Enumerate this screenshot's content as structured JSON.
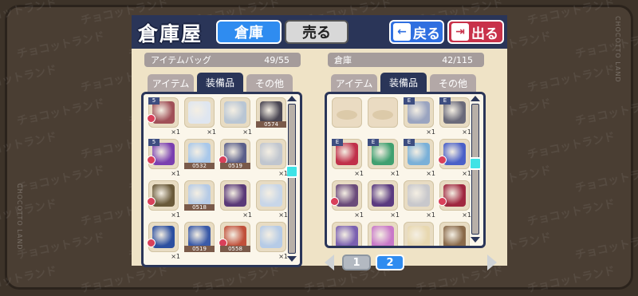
{
  "screen": {
    "title": "倉庫屋",
    "tabs": [
      {
        "label": "倉庫",
        "active": true
      },
      {
        "label": "売る",
        "active": false
      }
    ],
    "back_label": "戻る",
    "exit_label": "出る",
    "watermark": "チョコットランド",
    "side_text": "CHOCOTTO LAND"
  },
  "left_panel": {
    "name": "アイテムバッグ",
    "count": "49/55",
    "tabs": [
      "アイテム",
      "装備品",
      "その他"
    ],
    "selected_tab": "装備品",
    "scroll_position": 0.45,
    "items": [
      {
        "color": "#a05058",
        "qty": "×1",
        "star": "5",
        "minus": true,
        "lv": ""
      },
      {
        "color": "#dfe6f0",
        "qty": "×1",
        "star": "",
        "minus": false,
        "lv": ""
      },
      {
        "color": "#b9c6d4",
        "qty": "×1",
        "star": "",
        "minus": false,
        "lv": ""
      },
      {
        "color": "#4a4652",
        "qty": "",
        "star": "",
        "minus": false,
        "lv": "0574"
      },
      {
        "color": "#7a3fb0",
        "qty": "×1",
        "star": "5",
        "minus": true,
        "lv": ""
      },
      {
        "color": "#a9c8ea",
        "qty": "",
        "star": "",
        "minus": false,
        "lv": "0532"
      },
      {
        "color": "#5b5f8a",
        "qty": "",
        "star": "",
        "minus": true,
        "lv": "0519"
      },
      {
        "color": "#c0c6cf",
        "qty": "×1",
        "star": "",
        "minus": false,
        "lv": ""
      },
      {
        "color": "#6a5a3a",
        "qty": "×1",
        "star": "",
        "minus": true,
        "lv": ""
      },
      {
        "color": "#b6cbe6",
        "qty": "",
        "star": "",
        "minus": false,
        "lv": "0518"
      },
      {
        "color": "#5a3a78",
        "qty": "×1",
        "star": "",
        "minus": false,
        "lv": ""
      },
      {
        "color": "#c8d6e8",
        "qty": "×1",
        "star": "",
        "minus": false,
        "lv": ""
      },
      {
        "color": "#2c4fa0",
        "qty": "×1",
        "star": "",
        "minus": true,
        "lv": ""
      },
      {
        "color": "#3a5aa8",
        "qty": "",
        "star": "",
        "minus": false,
        "lv": "0519"
      },
      {
        "color": "#c0503a",
        "qty": "",
        "star": "",
        "minus": true,
        "lv": "0558"
      },
      {
        "color": "#b6cbe6",
        "qty": "×1",
        "star": "",
        "minus": false,
        "lv": ""
      }
    ]
  },
  "right_panel": {
    "name": "倉庫",
    "count": "42/115",
    "tabs": [
      "アイテム",
      "装備品",
      "その他"
    ],
    "selected_tab": "装備品",
    "scroll_position": 0.45,
    "items": [
      {
        "empty": true
      },
      {
        "empty": true
      },
      {
        "color": "#9aa4c0",
        "qty": "×1",
        "star": "E",
        "minus": false,
        "lv": ""
      },
      {
        "color": "#6a6a7a",
        "qty": "×1",
        "star": "E",
        "minus": false,
        "lv": ""
      },
      {
        "color": "#c0304a",
        "qty": "×1",
        "star": "E",
        "minus": false,
        "lv": ""
      },
      {
        "color": "#40a070",
        "qty": "×1",
        "star": "E",
        "minus": false,
        "lv": ""
      },
      {
        "color": "#7ab0d8",
        "qty": "×1",
        "star": "E",
        "minus": false,
        "lv": ""
      },
      {
        "color": "#4a60c8",
        "qty": "×1",
        "star": "",
        "minus": true,
        "lv": ""
      },
      {
        "color": "#6a4a7a",
        "qty": "×1",
        "star": "",
        "minus": true,
        "lv": ""
      },
      {
        "color": "#5a3a80",
        "qty": "×1",
        "star": "",
        "minus": false,
        "lv": ""
      },
      {
        "color": "#c8c8cc",
        "qty": "×1",
        "star": "",
        "minus": false,
        "lv": ""
      },
      {
        "color": "#a02840",
        "qty": "×1",
        "star": "",
        "minus": true,
        "lv": ""
      },
      {
        "color": "#7a60b0",
        "qty": "",
        "star": "",
        "minus": false,
        "lv": ""
      },
      {
        "color": "#c878c8",
        "qty": "",
        "star": "",
        "minus": false,
        "lv": ""
      },
      {
        "color": "#e8d8b0",
        "qty": "",
        "star": "",
        "minus": false,
        "lv": ""
      },
      {
        "color": "#8a6a4a",
        "qty": "",
        "star": "",
        "minus": false,
        "lv": ""
      }
    ],
    "pages": [
      "1",
      "2"
    ],
    "current_page": "2"
  },
  "colors": {
    "navy": "#2a3558",
    "accent_blue": "#2f8cf0",
    "exit_red": "#c8324a",
    "panel_bg": "#efe3c6",
    "scroll_thumb": "#3fe3e6"
  }
}
